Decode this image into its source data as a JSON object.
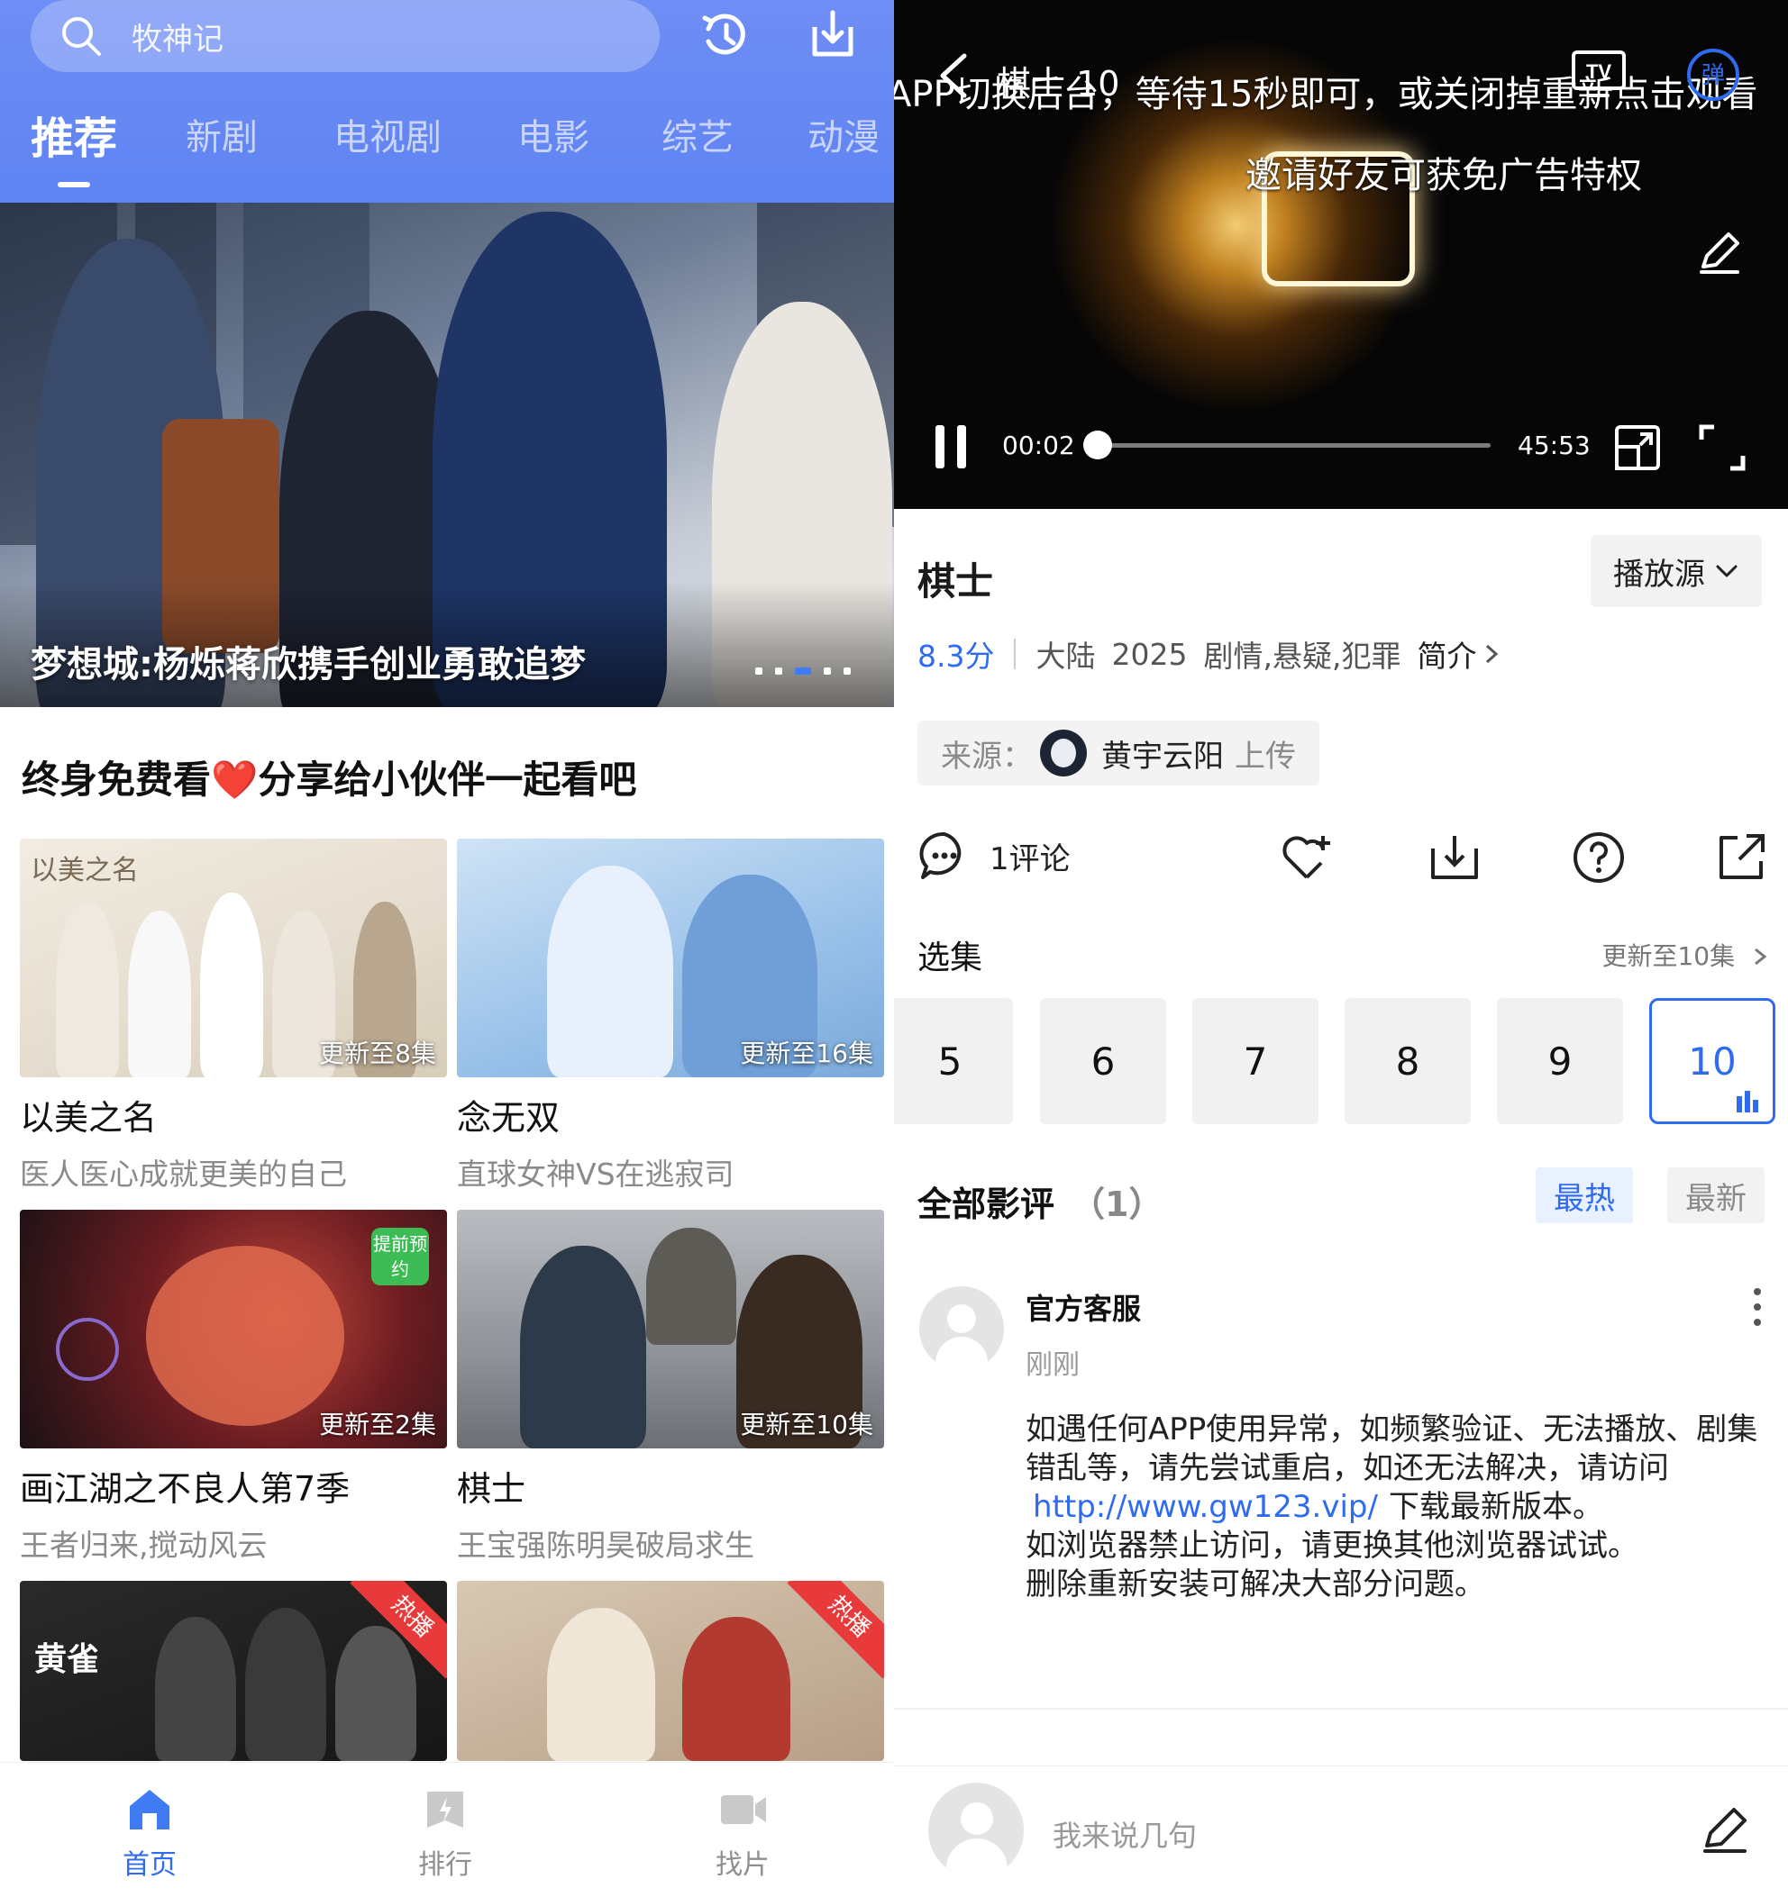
{
  "left": {
    "search": {
      "placeholder": "牧神记",
      "icons": [
        "search-icon",
        "history-icon",
        "download-icon"
      ]
    },
    "tabs": [
      "推荐",
      "新剧",
      "电视剧",
      "电影",
      "综艺",
      "动漫"
    ],
    "active_tab": "推荐",
    "banner": {
      "title": "梦想城:杨烁蒋欣携手创业勇敢追梦",
      "page_count": 5,
      "active_page": 3
    },
    "section_title": "终身免费看",
    "section_title_heart": "❤️",
    "section_title_rest": "分享给小伙伴一起看吧",
    "cards": [
      {
        "badge": "更新至8集",
        "title": "以美之名",
        "subtitle": "医人医心成就更美的自己",
        "poster_text": "以美之名"
      },
      {
        "badge": "更新至16集",
        "title": "念无双",
        "subtitle": "直球女神VS在逃寂司"
      },
      {
        "badge": "更新至2集",
        "title": "画江湖之不良人第7季",
        "subtitle": "王者归来,搅动风云",
        "poster_tag": "提前预约"
      },
      {
        "badge": "更新至10集",
        "title": "棋士",
        "subtitle": "王宝强陈明昊破局求生"
      },
      {
        "hot_label": "热播",
        "poster_text": "黄雀"
      },
      {
        "hot_label": "热播"
      }
    ],
    "bottom_nav": [
      {
        "label": "首页",
        "icon": "home-icon",
        "active": true
      },
      {
        "label": "排行",
        "icon": "ranking-icon",
        "active": false
      },
      {
        "label": "找片",
        "icon": "video-camera-icon",
        "active": false
      }
    ]
  },
  "right": {
    "player": {
      "title": "棋士 10",
      "overlay_line1": "APP切换后台，等待15秒即可，或关闭掉重新点击观看",
      "overlay_line2": "邀请好友可获免广告特权",
      "tv_label": "TV",
      "danmaku_label": "弹",
      "time_current": "00:02",
      "time_total": "45:53",
      "progress": 0.01,
      "icons": [
        "back-icon",
        "tv-cast-icon",
        "danmaku-icon",
        "edit-icon",
        "pause-icon",
        "pip-icon",
        "fullscreen-icon"
      ]
    },
    "show": {
      "title": "棋士",
      "source_button": "播放源",
      "score": "8.3分",
      "region": "大陆",
      "year": "2025",
      "genres": "剧情,悬疑,犯罪",
      "intro_link": "简介",
      "uploader_prefix": "来源：",
      "uploader_name": "黄宇云阳",
      "uploader_suffix": "上传"
    },
    "actions": {
      "comment_label": "1评论",
      "icons": [
        "comment-icon",
        "favorite-icon",
        "download-icon",
        "help-icon",
        "share-icon"
      ]
    },
    "episodes": {
      "label": "选集",
      "update_text": "更新至10集",
      "items": [
        "5",
        "6",
        "7",
        "8",
        "9",
        "10"
      ],
      "active": "10"
    },
    "reviews": {
      "title": "全部影评",
      "count": "（1）",
      "sort_hot": "最热",
      "sort_new": "最新",
      "items": [
        {
          "user": "官方客服",
          "time": "刚刚",
          "line1": "如遇任何APP使用异常，如频繁验证、无法播放、剧集错乱等，请先尝试重启，如还无法解决，请访问",
          "link": "http://www.gw123.vip/",
          "line2": "下载最新版本。",
          "line3": "如浏览器禁止访问，请更换其他浏览器试试。",
          "line4": "删除重新安装可解决大部分问题。"
        }
      ]
    },
    "composer": {
      "placeholder": "我来说几句"
    }
  },
  "colors": {
    "accent": "#2f6bf0",
    "header_gradient_top": "#6f8ef5",
    "hot_red": "#e83a3a"
  }
}
